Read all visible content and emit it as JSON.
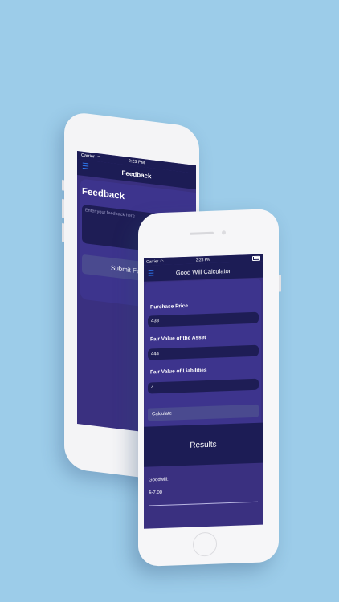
{
  "back_phone": {
    "status": {
      "carrier": "Carrier",
      "time": "2:23 PM"
    },
    "nav": {
      "title": "Feedback"
    },
    "heading": "Feedback",
    "feedback_placeholder": "Enter your feedback here",
    "submit_label": "Submit Fe"
  },
  "front_phone": {
    "status": {
      "carrier": "Carrier",
      "time": "2:23 PM"
    },
    "nav": {
      "title": "Good Will Calculator"
    },
    "purchase_price": {
      "label": "Purchase Price",
      "value": "433"
    },
    "fair_value_asset": {
      "label": "Fair Value of the Asset",
      "value": "444"
    },
    "fair_value_liabilities": {
      "label": "Fair Value of Liabilities",
      "value": "4"
    },
    "calculate_label": "Calculate",
    "results_title": "Results",
    "goodwill": {
      "label": "Goodwill:",
      "value": "$-7.00"
    }
  },
  "colors": {
    "background": "#9ccce9",
    "nav_bar": "#1c1c55",
    "screen": "#3a3080",
    "input": "#1e1d55",
    "button": "#4a4a8f",
    "menu_accent": "#2e7cf6"
  },
  "icons": [
    "menu-icon",
    "wifi-icon",
    "battery-icon"
  ]
}
